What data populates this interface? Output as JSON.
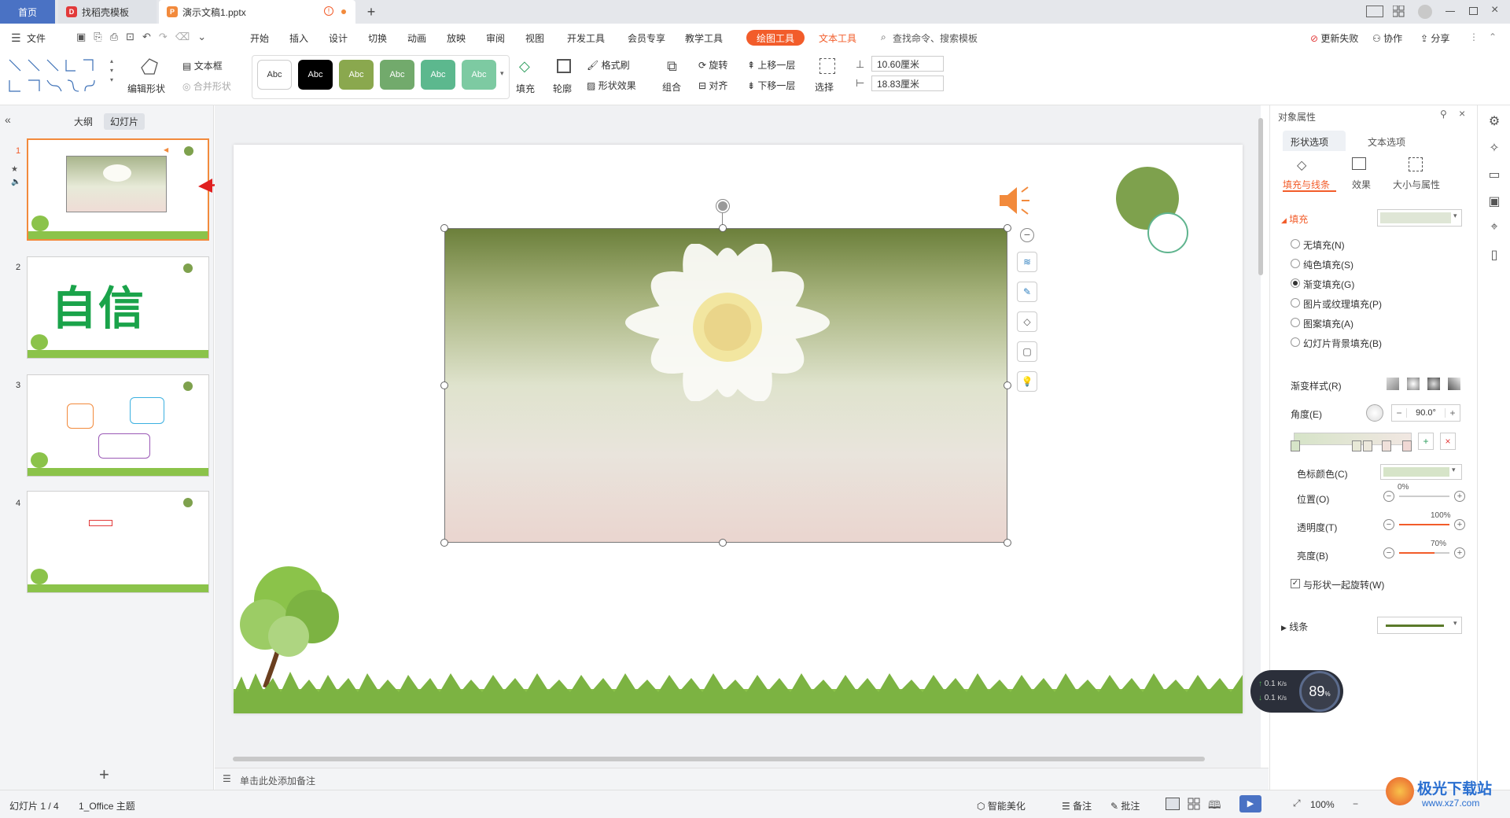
{
  "titlebar": {
    "tabs": [
      {
        "label": "首页"
      },
      {
        "label": "找稻壳模板"
      },
      {
        "label": "演示文稿1.pptx"
      }
    ],
    "new_tab": "+"
  },
  "menubar": {
    "file_label": "文件",
    "items": [
      "开始",
      "插入",
      "设计",
      "切换",
      "动画",
      "放映",
      "审阅",
      "视图",
      "开发工具",
      "会员专享",
      "教学工具"
    ],
    "active_tool": "绘图工具",
    "text_tool": "文本工具",
    "search_placeholder": "查找命令、搜索模板",
    "update_fail": "更新失败",
    "collab": "协作",
    "share": "分享"
  },
  "ribbon": {
    "edit_shape": "编辑形状",
    "textbox": "文本框",
    "merge_shape": "合并形状",
    "style_sample": "Abc",
    "fill": "填充",
    "outline": "轮廓",
    "format_painter": "格式刷",
    "shape_effect": "形状效果",
    "rotate": "旋转",
    "align": "对齐",
    "group": "组合",
    "bring_forward": "上移一层",
    "send_backward": "下移一层",
    "select": "选择",
    "height_value": "10.60厘米",
    "width_value": "18.83厘米"
  },
  "leftpanel": {
    "tab_outline": "大纲",
    "tab_slides": "幻灯片",
    "slide_numbers": [
      "1",
      "2",
      "3",
      "4"
    ],
    "slide2_text": "自信",
    "add_slide": "+"
  },
  "canvas": {
    "notes_placeholder": "单击此处添加备注"
  },
  "rightpanel": {
    "title": "对象属性",
    "tab_shape": "形状选项",
    "tab_text": "文本选项",
    "sub_fill_line": "填充与线条",
    "sub_effect": "效果",
    "sub_size": "大小与属性",
    "section_fill": "填充",
    "fill_options": [
      "无填充(N)",
      "纯色填充(S)",
      "渐变填充(G)",
      "图片或纹理填充(P)",
      "图案填充(A)",
      "幻灯片背景填充(B)"
    ],
    "selected_fill_index": 2,
    "gradient_style": "渐变样式(R)",
    "angle_label": "角度(E)",
    "angle_value": "90.0°",
    "stop_color_label": "色标颜色(C)",
    "position_label": "位置(O)",
    "position_value": "0%",
    "transparency_label": "透明度(T)",
    "transparency_value": "100%",
    "brightness_label": "亮度(B)",
    "brightness_value": "70%",
    "rotate_with_shape": "与形状一起旋转(W)",
    "section_line": "线条",
    "colors": {
      "accent": "#f25c2a",
      "fill_swatch": "#dfe6d6",
      "stop_color": "#d6e4c8",
      "line_color": "#5a7a2a"
    }
  },
  "netwidget": {
    "up": "0.1",
    "down": "0.1",
    "unit": "K/s",
    "percent": "89",
    "percent_sign": "%"
  },
  "statusbar": {
    "slide_info": "幻灯片 1 / 4",
    "theme": "1_Office 主题",
    "smart_beautify": "智能美化",
    "notes": "备注",
    "comments": "批注",
    "zoom": "100%"
  },
  "watermark": {
    "text": "极光下载站",
    "url": "www.xz7.com"
  }
}
